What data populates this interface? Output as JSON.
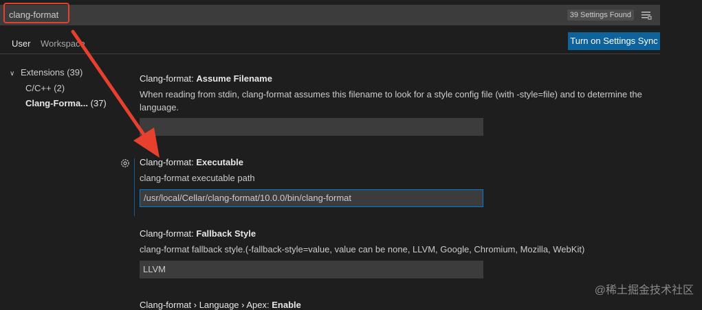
{
  "search": {
    "query": "clang-format",
    "result_count": "39 Settings Found",
    "filter_icon": "filter-lines-icon"
  },
  "tabs": {
    "user": "User",
    "workspace": "Workspace"
  },
  "sync_button": "Turn on Settings Sync",
  "toc": {
    "extensions": {
      "label": "Extensions",
      "count": "(39)"
    },
    "items": [
      {
        "label": "C/C++",
        "count": "(2)"
      },
      {
        "label": "Clang-Forma...",
        "count": "(37)"
      }
    ]
  },
  "settings": [
    {
      "prefix": "Clang-format: ",
      "name": "Assume Filename",
      "description": "When reading from stdin, clang-format assumes this filename to look for a style config file (with -style=file) and to determine the language.",
      "value": ""
    },
    {
      "prefix": "Clang-format: ",
      "name": "Executable",
      "description": "clang-format executable path",
      "value": "/usr/local/Cellar/clang-format/10.0.0/bin/clang-format"
    },
    {
      "prefix": "Clang-format: ",
      "name": "Fallback Style",
      "description": "clang-format fallback style.(-fallback-style=value, value can be none, LLVM, Google, Chromium, Mozilla, WebKit)",
      "value": "LLVM"
    },
    {
      "prefix": "Clang-format › Language › Apex: ",
      "name": "Enable"
    }
  ],
  "annotation": {
    "color": "#e8402e"
  },
  "watermark": "@稀土掘金技术社区"
}
